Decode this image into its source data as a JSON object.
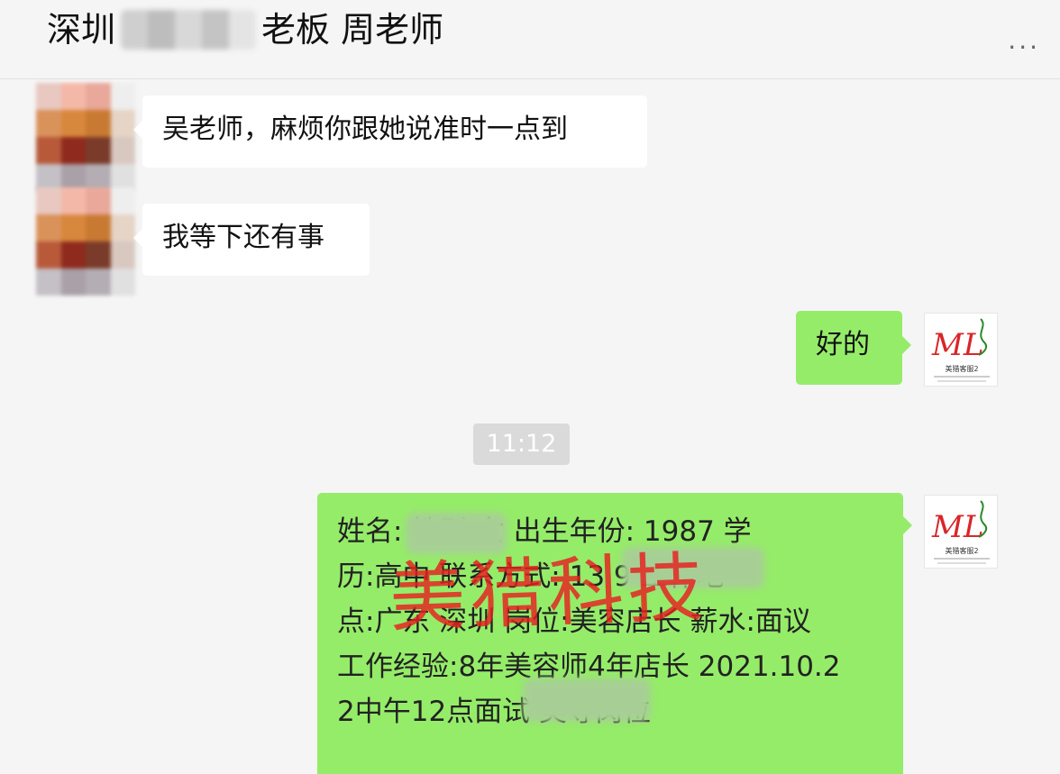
{
  "header": {
    "title_prefix": "深圳",
    "title_suffix": "老板  周老师",
    "more": "..."
  },
  "messages": [
    {
      "side": "left",
      "text": "吴老师，麻烦你跟她说准时一点到"
    },
    {
      "side": "left",
      "text": "我等下还有事"
    },
    {
      "side": "right",
      "text": "好的"
    }
  ],
  "timestamp": "11:12",
  "resume_message": {
    "lines": [
      "姓名:          性别:女 出生年份: 1987 学",
      "历:高中 联系方式: 13          9 工作地",
      "点:广东 深圳 岗位:美容店长 薪水:面议",
      "工作经验:8年美容师4年店长 2021.10.2",
      "2中午12点面试         美导岗位"
    ]
  },
  "watermark": "美猎科技",
  "logo": {
    "mark": "ML",
    "caption": "美猎客服2",
    "accent": "#d9262a"
  },
  "colors": {
    "self_bubble": "#95ec69",
    "other_bubble": "#ffffff",
    "background": "#f5f5f5"
  }
}
